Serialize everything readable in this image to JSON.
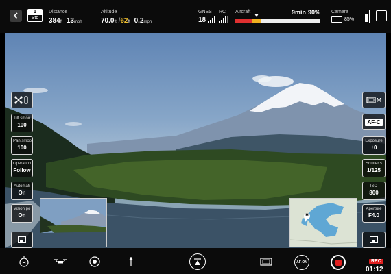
{
  "topbar": {
    "mode": {
      "top": "1",
      "bottom": "Std"
    },
    "distance": {
      "label": "Distance",
      "value": "384",
      "unit": "ft",
      "speed": "13",
      "speed_unit": "mph"
    },
    "altitude": {
      "label": "Altitude",
      "value": "70.0",
      "unit": "ft",
      "value2": "62",
      "unit2": "ft",
      "speed": "0.2",
      "speed_unit": "mph"
    },
    "gnss": {
      "label": "GNSS",
      "count": "18"
    },
    "rc": {
      "label": "RC"
    },
    "aircraft": {
      "label": "Aircraft",
      "time": "9min",
      "percent": "90%",
      "battery_fraction": 0.9
    },
    "camera": {
      "label": "Camera",
      "battery": "85%"
    },
    "colors": {
      "alert": "#e03030",
      "warning": "#f0b020",
      "highlight": "#f0c030"
    }
  },
  "left_panel": {
    "gimbal_icon": "drone-gimbal-icon",
    "buttons": [
      {
        "label": "Tilt smoo",
        "value": "100"
      },
      {
        "label": "Pan smoo",
        "value": "100"
      },
      {
        "label": "Operation",
        "value": "Follow"
      },
      {
        "label": "Automati",
        "value": "On"
      },
      {
        "label": "Vision po",
        "value": "On"
      }
    ]
  },
  "right_panel": {
    "film_mode": "M",
    "focus_mode": "AF-C",
    "buttons": [
      {
        "label": "Exposure",
        "value": "±0"
      },
      {
        "label": "Shutter s",
        "value": "1/125"
      },
      {
        "label": "ISO",
        "value": "800"
      },
      {
        "label": "Aperture",
        "value": "F4.0"
      }
    ]
  },
  "map": {
    "home_marker": "H"
  },
  "bottombar": {
    "icons": [
      "home-return-icon",
      "aircraft-icon",
      "camera-switch-icon",
      "orientation-icon",
      "takeoff-icon",
      "frame-icon",
      "af-on-icon",
      "record-icon"
    ],
    "af_on": "AF-ON",
    "rec_label": "REC",
    "rec_time": "01:12"
  }
}
